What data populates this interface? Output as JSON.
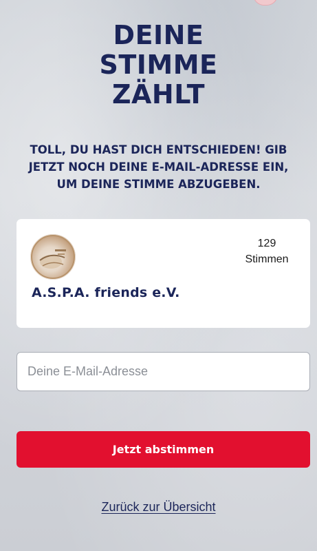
{
  "headline": {
    "line1": "DEINE",
    "line2": "STIMME",
    "line3": "ZÄHLT"
  },
  "subline": {
    "line1": "TOLL, DU HAST DICH ENTSCHIEDEN! GIB",
    "line2": "JETZT NOCH DEINE E-MAIL-ADRESSE EIN,",
    "line3": "UM DEINE STIMME ABZUGEBEN."
  },
  "candidate": {
    "logo_icon": "aspa-friends-logo",
    "votes_count": "129",
    "votes_label": "Stimmen",
    "name": "A.S.P.A. friends e.V."
  },
  "form": {
    "email_placeholder": "Deine E-Mail-Adresse",
    "email_value": "",
    "submit_label": "Jetzt abstimmen"
  },
  "footer": {
    "back_label": "Zurück zur Übersicht"
  },
  "colors": {
    "headline": "#1b2559",
    "button": "#e2102f",
    "card": "#ffffff"
  }
}
